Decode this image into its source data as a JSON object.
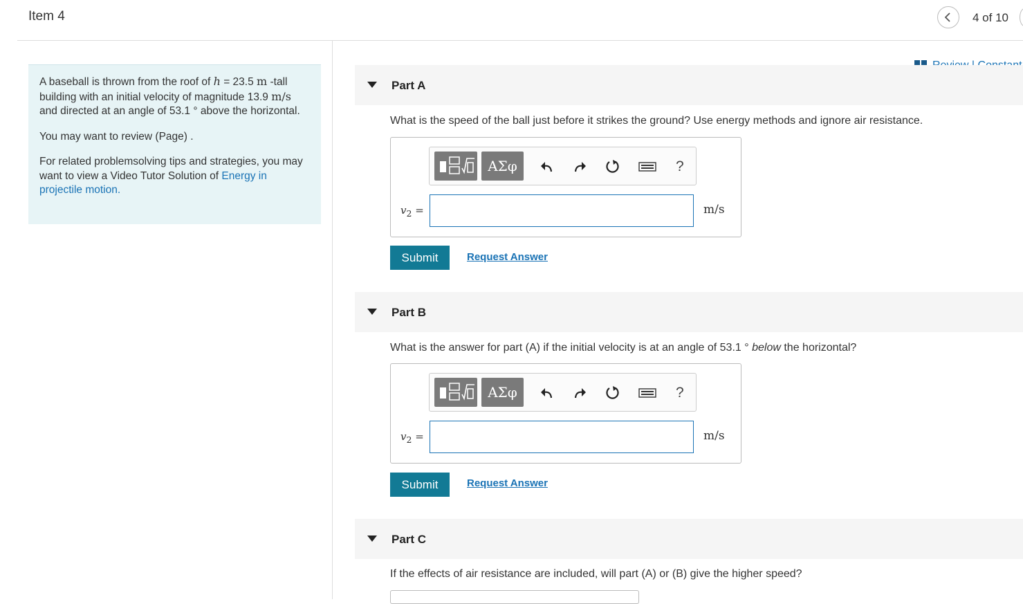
{
  "header": {
    "item_title": "Item 4",
    "prev_icon": "chevron-left-icon",
    "position": "4 of 10"
  },
  "review": {
    "icon": "book-icon",
    "text": "Review | Constant"
  },
  "intro": {
    "p1_a": "A baseball is thrown from the roof of ",
    "h_var": "h",
    "p1_b": " = 23.5 ",
    "unit_m": "m",
    "p1_c": " -tall building with an initial velocity of magnitude 13.9 ",
    "unit_ms": "m/s",
    "p1_d": " and directed at an angle of 53.1 ° above the horizontal.",
    "p2": "You may want to review (Page) .",
    "p3_a": "For related problemsolving tips and strategies, you may want to view a Video Tutor Solution of ",
    "p3_link": "Energy in projectile motion.",
    "p3_b": ""
  },
  "parts": {
    "a": {
      "label": "Part A",
      "question": "What is the speed of the ball just before it strikes the ground? Use energy methods and ignore air resistance.",
      "var_label": "v",
      "var_sub": "2",
      "eq": " =",
      "unit": "m/s",
      "submit": "Submit",
      "request": "Request Answer"
    },
    "b": {
      "label": "Part B",
      "question_a": "What is the answer for part (A) if the initial velocity is at an angle of 53.1 ° ",
      "question_em": "below",
      "question_b": " the horizontal?",
      "var_label": "v",
      "var_sub": "2",
      "eq": " =",
      "unit": "m/s",
      "submit": "Submit",
      "request": "Request Answer"
    },
    "c": {
      "label": "Part C",
      "question": "If the effects of air resistance are included, will part (A) or (B) give the higher speed?"
    }
  },
  "toolbar": {
    "templates_icon": "templates-icon",
    "greek": "ΑΣφ",
    "undo_icon": "undo-icon",
    "redo_icon": "redo-icon",
    "reset_icon": "reset-icon",
    "keyboard_icon": "keyboard-icon",
    "help": "?"
  }
}
